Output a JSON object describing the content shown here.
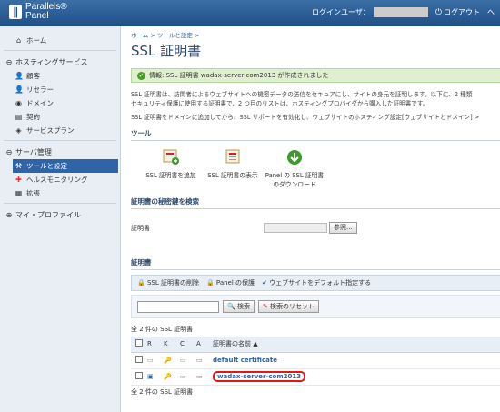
{
  "header": {
    "logo_top": "Parallels®",
    "logo_bottom": "Panel",
    "user_label": "ログインユーザ：",
    "logout_label": "ログアウト",
    "help_label": "ヘ"
  },
  "sidebar": {
    "home": "ホーム",
    "hosting_section": "ホスティングサービス",
    "hosting_items": [
      "顧客",
      "リセラー",
      "ドメイン",
      "契約",
      "サービスプラン"
    ],
    "server_section": "サーバ管理",
    "server_items": [
      "ツールと設定",
      "ヘルスモニタリング",
      "拡張"
    ],
    "profile_section": "マイ・プロファイル"
  },
  "main": {
    "breadcrumb": "ホーム > ツールと設定 >",
    "title": "SSL 証明書",
    "info_text": "情報: SSL 証明書 wadax-server-com2013 が作成されました",
    "desc_line1": "SSL 証明書は、訪問者によるウェブサイトへの機密データの送信をセキュアにし、サイトの身元を証明します。以下に、2 種類",
    "desc_line2": "セキュリティ保護に使用する証明書で、2 つ目のリストは、ホスティングプロバイダから購入した証明書です。",
    "desc_line3": "SSL 証明書をドメインに追加してから、SSL サポートを有効化し、ウェブサイトのホスティング設定[ウェブサイトとドメイン] >",
    "tools_heading": "ツール",
    "tools": [
      "SSL 証明書を追加",
      "SSL 証明書の表示",
      "Panel の SSL 証明書のダウンロード"
    ],
    "search_heading": "証明書の秘密鍵を検索",
    "cert_label": "証明書",
    "browse_label": "参照...",
    "certs_heading": "証明書",
    "toolbar": {
      "delete": "SSL 証明書の削除",
      "protect": "Panel の保護",
      "set_default": "ウェブサイトをデフォルト指定する"
    },
    "search_btn": "検索",
    "reset_btn": "検索のリセット",
    "count_text": "全 2 件の SSL 証明書",
    "columns": [
      "R",
      "K",
      "C",
      "A",
      "証明書の名前"
    ],
    "rows": [
      "default certificate",
      "wadax-server-com2013"
    ],
    "count_bottom": "全 2 件の SSL 証明書"
  },
  "colors": {
    "accent": "#2e64a8",
    "success": "#4a9a2c",
    "highlight": "#e01818"
  }
}
